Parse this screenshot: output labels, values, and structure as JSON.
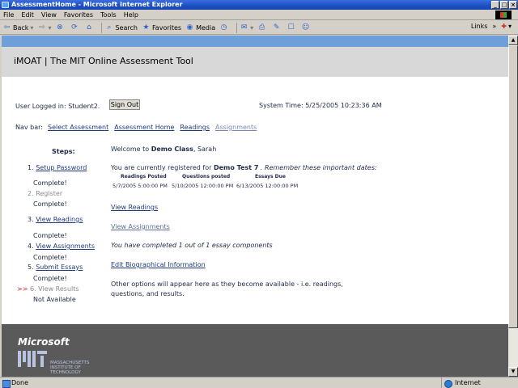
{
  "window": {
    "title": "AssessmentHome - Microsoft Internet Explorer"
  },
  "menu": [
    "File",
    "Edit",
    "View",
    "Favorites",
    "Tools",
    "Help"
  ],
  "toolbar": {
    "back": "Back",
    "search": "Search",
    "favorites": "Favorites",
    "media": "Media",
    "links": "Links"
  },
  "page": {
    "title": "iMOAT | The MIT Online Assessment Tool",
    "logged_in": "User Logged in: Student2.",
    "sign_out": "Sign Out",
    "system_time": "System Time: 5/25/2005 10:23:36 AM",
    "nav_label": "Nav bar:",
    "nav": [
      "Select Assessment",
      "Assessment Home",
      "Readings",
      "Assignments"
    ]
  },
  "steps": {
    "title": "Steps:",
    "items": [
      {
        "num": "1.",
        "label": "Setup Password",
        "status": "Complete!"
      },
      {
        "num": "2.",
        "label": "Register",
        "status": "Complete!"
      },
      {
        "num": "3.",
        "label": "View Readings",
        "status": "Complete!"
      },
      {
        "num": "4.",
        "label": "View Assignments",
        "status": "Complete!"
      },
      {
        "num": "5.",
        "label": "Submit Essays",
        "status": "Complete!"
      },
      {
        "num": "6.",
        "label": "View Results",
        "status": "Not Available",
        "marker": ">>"
      }
    ]
  },
  "main": {
    "welcome_prefix": "Welcome to ",
    "class_name": "Demo Class",
    "welcome_suffix": ", Sarah",
    "registered_prefix": "You are currently registered for ",
    "test_name": "Demo Test 7",
    "registered_suffix": " . Remember these important dates:",
    "dates_headers": [
      "Readings Posted",
      "Questions posted",
      "Essays Due"
    ],
    "dates_values": [
      "5/7/2005 5:00:00 PM",
      "5/10/2005 12:00:00 PM",
      "6/13/2005 12:00:00 PM"
    ],
    "view_readings": "View Readings",
    "view_assignments": "View Assignments",
    "completed_note": "You have completed 1 out of 1 essay components",
    "edit_bio": "Edit Biographical Information",
    "other_options_1": "Other options will appear here as they become available - i.e. readings,",
    "other_options_2": "questions, and results."
  },
  "footer": {
    "microsoft": "Microsoft",
    "mit_lines": [
      "MASSACHUSETTS",
      "INSTITUTE OF",
      "TECHNOLOGY"
    ]
  },
  "status": {
    "left": "Done",
    "zone": "Internet"
  }
}
